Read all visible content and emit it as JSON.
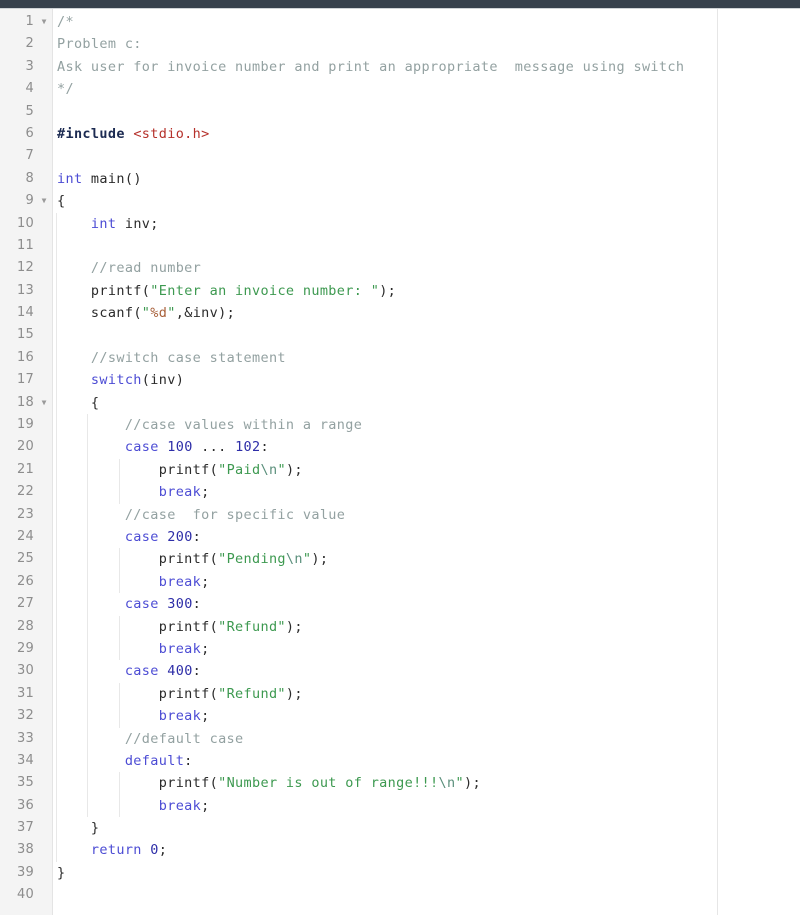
{
  "window": {
    "titlebar_color": "#37414c",
    "editor_background": "#ffffff",
    "gutter_background": "#f4f4f4"
  },
  "editor": {
    "language": "c",
    "first_line": 1,
    "last_line": 40,
    "margin_column_x": 717,
    "fold_marker_glyph": "▼",
    "fold_lines": [
      1,
      9,
      18
    ],
    "colors": {
      "comment": "#93a1a1",
      "keyword": "#4c4cd4",
      "preprocessor": "#1c2b52",
      "header_name": "#b5312b",
      "string": "#3d9950",
      "escape": "#5a8f7b",
      "format_specifier": "#a8603a",
      "number": "#2e2ea8",
      "plain": "#2b2b2b",
      "line_number": "#8d8d8d"
    },
    "lines": [
      {
        "n": "1",
        "fold": true,
        "indent": 0,
        "tokens": [
          {
            "t": "comment",
            "v": "/*"
          }
        ]
      },
      {
        "n": "2",
        "fold": false,
        "indent": 0,
        "tokens": [
          {
            "t": "comment",
            "v": "Problem c:"
          }
        ]
      },
      {
        "n": "3",
        "fold": false,
        "indent": 0,
        "tokens": [
          {
            "t": "comment",
            "v": "Ask user for invoice number and print an appropriate  message using switch"
          }
        ]
      },
      {
        "n": "4",
        "fold": false,
        "indent": 0,
        "tokens": [
          {
            "t": "comment",
            "v": "*/"
          }
        ]
      },
      {
        "n": "5",
        "fold": false,
        "indent": 0,
        "tokens": []
      },
      {
        "n": "6",
        "fold": false,
        "indent": 0,
        "tokens": [
          {
            "t": "preproc",
            "v": "#include"
          },
          {
            "t": "plain",
            "v": " "
          },
          {
            "t": "header",
            "v": "<stdio.h>"
          }
        ]
      },
      {
        "n": "7",
        "fold": false,
        "indent": 0,
        "tokens": []
      },
      {
        "n": "8",
        "fold": false,
        "indent": 0,
        "tokens": [
          {
            "t": "keyword",
            "v": "int"
          },
          {
            "t": "plain",
            "v": " "
          },
          {
            "t": "func",
            "v": "main"
          },
          {
            "t": "punct",
            "v": "()"
          }
        ]
      },
      {
        "n": "9",
        "fold": true,
        "indent": 0,
        "tokens": [
          {
            "t": "punct",
            "v": "{"
          }
        ]
      },
      {
        "n": "10",
        "fold": false,
        "indent": 1,
        "tokens": [
          {
            "t": "plain",
            "v": "    "
          },
          {
            "t": "keyword",
            "v": "int"
          },
          {
            "t": "plain",
            "v": " inv;"
          }
        ]
      },
      {
        "n": "11",
        "fold": false,
        "indent": 1,
        "tokens": []
      },
      {
        "n": "12",
        "fold": false,
        "indent": 1,
        "tokens": [
          {
            "t": "plain",
            "v": "    "
          },
          {
            "t": "comment",
            "v": "//read number"
          }
        ]
      },
      {
        "n": "13",
        "fold": false,
        "indent": 1,
        "tokens": [
          {
            "t": "plain",
            "v": "    "
          },
          {
            "t": "func",
            "v": "printf"
          },
          {
            "t": "punct",
            "v": "("
          },
          {
            "t": "string",
            "v": "\"Enter an invoice number: \""
          },
          {
            "t": "punct",
            "v": ");"
          }
        ]
      },
      {
        "n": "14",
        "fold": false,
        "indent": 1,
        "tokens": [
          {
            "t": "plain",
            "v": "    "
          },
          {
            "t": "func",
            "v": "scanf"
          },
          {
            "t": "punct",
            "v": "("
          },
          {
            "t": "string",
            "v": "\""
          },
          {
            "t": "fmt",
            "v": "%d"
          },
          {
            "t": "string",
            "v": "\""
          },
          {
            "t": "punct",
            "v": ",&inv);"
          }
        ]
      },
      {
        "n": "15",
        "fold": false,
        "indent": 1,
        "tokens": []
      },
      {
        "n": "16",
        "fold": false,
        "indent": 1,
        "tokens": [
          {
            "t": "plain",
            "v": "    "
          },
          {
            "t": "comment",
            "v": "//switch case statement"
          }
        ]
      },
      {
        "n": "17",
        "fold": false,
        "indent": 1,
        "tokens": [
          {
            "t": "plain",
            "v": "    "
          },
          {
            "t": "keyword",
            "v": "switch"
          },
          {
            "t": "punct",
            "v": "("
          },
          {
            "t": "plain",
            "v": "inv"
          },
          {
            "t": "punct",
            "v": ")"
          }
        ]
      },
      {
        "n": "18",
        "fold": true,
        "indent": 1,
        "tokens": [
          {
            "t": "plain",
            "v": "    "
          },
          {
            "t": "punct",
            "v": "{"
          }
        ]
      },
      {
        "n": "19",
        "fold": false,
        "indent": 2,
        "tokens": [
          {
            "t": "plain",
            "v": "        "
          },
          {
            "t": "comment",
            "v": "//case values within a range"
          }
        ]
      },
      {
        "n": "20",
        "fold": false,
        "indent": 2,
        "tokens": [
          {
            "t": "plain",
            "v": "        "
          },
          {
            "t": "keyword",
            "v": "case"
          },
          {
            "t": "plain",
            "v": " "
          },
          {
            "t": "number",
            "v": "100"
          },
          {
            "t": "plain",
            "v": " "
          },
          {
            "t": "punct",
            "v": "..."
          },
          {
            "t": "plain",
            "v": " "
          },
          {
            "t": "number",
            "v": "102"
          },
          {
            "t": "punct",
            "v": ":"
          }
        ]
      },
      {
        "n": "21",
        "fold": false,
        "indent": 3,
        "tokens": [
          {
            "t": "plain",
            "v": "            "
          },
          {
            "t": "func",
            "v": "printf"
          },
          {
            "t": "punct",
            "v": "("
          },
          {
            "t": "string",
            "v": "\"Paid"
          },
          {
            "t": "escape",
            "v": "\\n"
          },
          {
            "t": "string",
            "v": "\""
          },
          {
            "t": "punct",
            "v": ");"
          }
        ]
      },
      {
        "n": "22",
        "fold": false,
        "indent": 3,
        "tokens": [
          {
            "t": "plain",
            "v": "            "
          },
          {
            "t": "keyword",
            "v": "break"
          },
          {
            "t": "punct",
            "v": ";"
          }
        ]
      },
      {
        "n": "23",
        "fold": false,
        "indent": 2,
        "tokens": [
          {
            "t": "plain",
            "v": "        "
          },
          {
            "t": "comment",
            "v": "//case  for specific value"
          }
        ]
      },
      {
        "n": "24",
        "fold": false,
        "indent": 2,
        "tokens": [
          {
            "t": "plain",
            "v": "        "
          },
          {
            "t": "keyword",
            "v": "case"
          },
          {
            "t": "plain",
            "v": " "
          },
          {
            "t": "number",
            "v": "200"
          },
          {
            "t": "punct",
            "v": ":"
          }
        ]
      },
      {
        "n": "25",
        "fold": false,
        "indent": 3,
        "tokens": [
          {
            "t": "plain",
            "v": "            "
          },
          {
            "t": "func",
            "v": "printf"
          },
          {
            "t": "punct",
            "v": "("
          },
          {
            "t": "string",
            "v": "\"Pending"
          },
          {
            "t": "escape",
            "v": "\\n"
          },
          {
            "t": "string",
            "v": "\""
          },
          {
            "t": "punct",
            "v": ");"
          }
        ]
      },
      {
        "n": "26",
        "fold": false,
        "indent": 3,
        "tokens": [
          {
            "t": "plain",
            "v": "            "
          },
          {
            "t": "keyword",
            "v": "break"
          },
          {
            "t": "punct",
            "v": ";"
          }
        ]
      },
      {
        "n": "27",
        "fold": false,
        "indent": 2,
        "tokens": [
          {
            "t": "plain",
            "v": "        "
          },
          {
            "t": "keyword",
            "v": "case"
          },
          {
            "t": "plain",
            "v": " "
          },
          {
            "t": "number",
            "v": "300"
          },
          {
            "t": "punct",
            "v": ":"
          }
        ]
      },
      {
        "n": "28",
        "fold": false,
        "indent": 3,
        "tokens": [
          {
            "t": "plain",
            "v": "            "
          },
          {
            "t": "func",
            "v": "printf"
          },
          {
            "t": "punct",
            "v": "("
          },
          {
            "t": "string",
            "v": "\"Refund\""
          },
          {
            "t": "punct",
            "v": ");"
          }
        ]
      },
      {
        "n": "29",
        "fold": false,
        "indent": 3,
        "tokens": [
          {
            "t": "plain",
            "v": "            "
          },
          {
            "t": "keyword",
            "v": "break"
          },
          {
            "t": "punct",
            "v": ";"
          }
        ]
      },
      {
        "n": "30",
        "fold": false,
        "indent": 2,
        "tokens": [
          {
            "t": "plain",
            "v": "        "
          },
          {
            "t": "keyword",
            "v": "case"
          },
          {
            "t": "plain",
            "v": " "
          },
          {
            "t": "number",
            "v": "400"
          },
          {
            "t": "punct",
            "v": ":"
          }
        ]
      },
      {
        "n": "31",
        "fold": false,
        "indent": 3,
        "tokens": [
          {
            "t": "plain",
            "v": "            "
          },
          {
            "t": "func",
            "v": "printf"
          },
          {
            "t": "punct",
            "v": "("
          },
          {
            "t": "string",
            "v": "\"Refund\""
          },
          {
            "t": "punct",
            "v": ");"
          }
        ]
      },
      {
        "n": "32",
        "fold": false,
        "indent": 3,
        "tokens": [
          {
            "t": "plain",
            "v": "            "
          },
          {
            "t": "keyword",
            "v": "break"
          },
          {
            "t": "punct",
            "v": ";"
          }
        ]
      },
      {
        "n": "33",
        "fold": false,
        "indent": 2,
        "tokens": [
          {
            "t": "plain",
            "v": "        "
          },
          {
            "t": "comment",
            "v": "//default case"
          }
        ]
      },
      {
        "n": "34",
        "fold": false,
        "indent": 2,
        "tokens": [
          {
            "t": "plain",
            "v": "        "
          },
          {
            "t": "keyword",
            "v": "default"
          },
          {
            "t": "punct",
            "v": ":"
          }
        ]
      },
      {
        "n": "35",
        "fold": false,
        "indent": 3,
        "tokens": [
          {
            "t": "plain",
            "v": "            "
          },
          {
            "t": "func",
            "v": "printf"
          },
          {
            "t": "punct",
            "v": "("
          },
          {
            "t": "string",
            "v": "\"Number is out of range!!!"
          },
          {
            "t": "escape",
            "v": "\\n"
          },
          {
            "t": "string",
            "v": "\""
          },
          {
            "t": "punct",
            "v": ");"
          }
        ]
      },
      {
        "n": "36",
        "fold": false,
        "indent": 3,
        "tokens": [
          {
            "t": "plain",
            "v": "            "
          },
          {
            "t": "keyword",
            "v": "break"
          },
          {
            "t": "punct",
            "v": ";"
          }
        ]
      },
      {
        "n": "37",
        "fold": false,
        "indent": 1,
        "tokens": [
          {
            "t": "plain",
            "v": "    "
          },
          {
            "t": "punct",
            "v": "}"
          }
        ]
      },
      {
        "n": "38",
        "fold": false,
        "indent": 1,
        "tokens": [
          {
            "t": "plain",
            "v": "    "
          },
          {
            "t": "keyword",
            "v": "return"
          },
          {
            "t": "plain",
            "v": " "
          },
          {
            "t": "number",
            "v": "0"
          },
          {
            "t": "punct",
            "v": ";"
          }
        ]
      },
      {
        "n": "39",
        "fold": false,
        "indent": 0,
        "tokens": [
          {
            "t": "punct",
            "v": "}"
          }
        ]
      },
      {
        "n": "40",
        "fold": false,
        "indent": 0,
        "tokens": []
      }
    ]
  }
}
